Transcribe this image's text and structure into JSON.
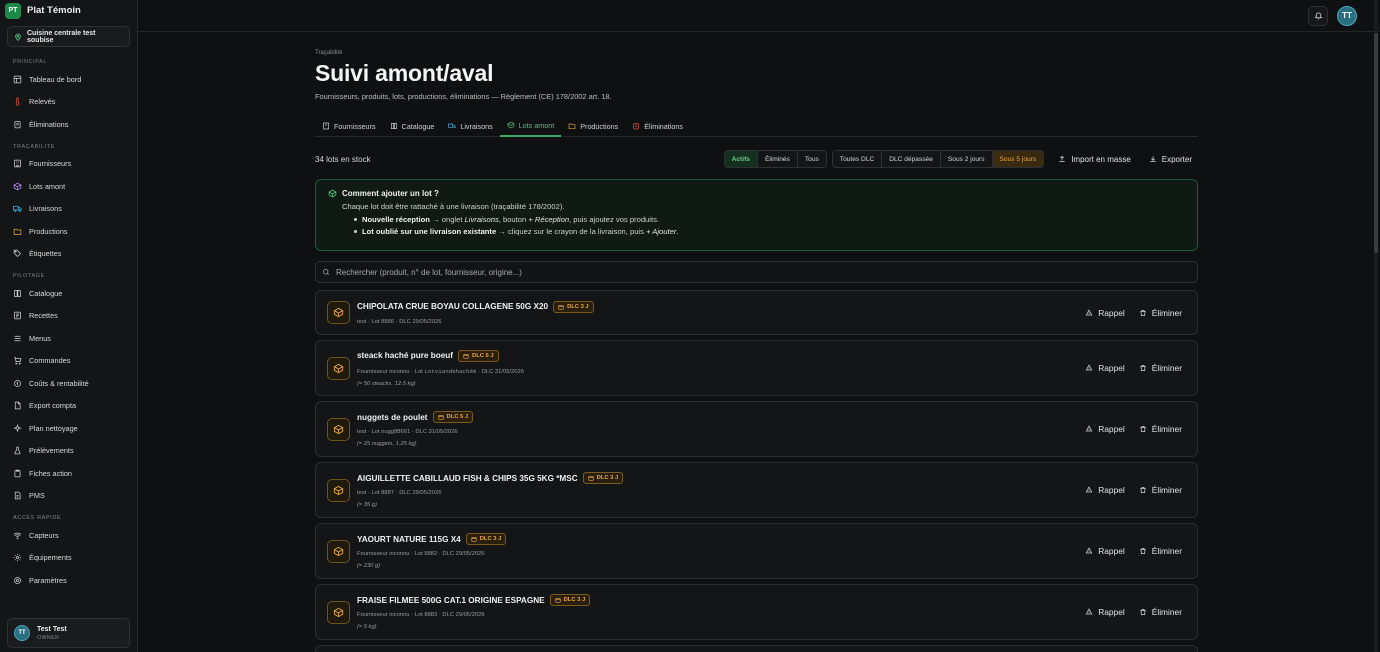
{
  "app": {
    "logo": "PT",
    "name": "Plat Témoin"
  },
  "site": {
    "label": "Cuisine centrale test soubise"
  },
  "sidebar": {
    "sections": [
      {
        "title": "PRINCIPAL",
        "items": [
          {
            "label": "Tableau de bord",
            "icon": "dashboard-icon"
          },
          {
            "label": "Relevés",
            "icon": "thermometer-icon"
          },
          {
            "label": "Éliminations",
            "icon": "trash-icon"
          }
        ]
      },
      {
        "title": "TRAÇABILITÉ",
        "items": [
          {
            "label": "Fournisseurs",
            "icon": "building-icon"
          },
          {
            "label": "Lots amont",
            "icon": "package-icon"
          },
          {
            "label": "Livraisons",
            "icon": "truck-icon"
          },
          {
            "label": "Productions",
            "icon": "folder-icon"
          },
          {
            "label": "Étiquettes",
            "icon": "tag-icon"
          }
        ]
      },
      {
        "title": "PILOTAGE",
        "items": [
          {
            "label": "Catalogue",
            "icon": "book-icon"
          },
          {
            "label": "Recettes",
            "icon": "list-icon"
          },
          {
            "label": "Menus",
            "icon": "menu-icon"
          },
          {
            "label": "Commandes",
            "icon": "cart-icon"
          },
          {
            "label": "Coûts & rentabilité",
            "icon": "coins-icon"
          },
          {
            "label": "Export compta",
            "icon": "file-icon"
          },
          {
            "label": "Plan nettoyage",
            "icon": "sparkle-icon"
          },
          {
            "label": "Prélèvements",
            "icon": "flask-icon"
          },
          {
            "label": "Fiches action",
            "icon": "clipboard-icon"
          },
          {
            "label": "PMS",
            "icon": "document-icon"
          }
        ]
      },
      {
        "title": "ACCÈS RAPIDE",
        "items": [
          {
            "label": "Capteurs",
            "icon": "wifi-icon"
          },
          {
            "label": "Équipements",
            "icon": "gear-icon"
          },
          {
            "label": "Paramètres",
            "icon": "settings-icon"
          }
        ]
      }
    ],
    "user": {
      "initials": "TT",
      "name": "Test Test",
      "role": "OWNER"
    }
  },
  "topbar": {
    "avatar": "TT"
  },
  "page": {
    "eyebrow": "Traçabilité",
    "title": "Suivi amont/aval",
    "subtitle": "Fournisseurs, produits, lots, productions, éliminations — Règlement (CE) 178/2002 art. 18."
  },
  "tabs": [
    "Fournisseurs",
    "Catalogue",
    "Livraisons",
    "Lots amont",
    "Productions",
    "Éliminations"
  ],
  "toolbar": {
    "count": "34 lots en stock",
    "status_filters": [
      "Actifs",
      "Éliminés",
      "Tous"
    ],
    "dlc_filters": [
      "Toutes DLC",
      "DLC dépassée",
      "Sous 2 jours",
      "Sous 5 jours"
    ],
    "import_label": "Import en masse",
    "export_label": "Exporter"
  },
  "info": {
    "title": "Comment ajouter un lot ?",
    "line": "Chaque lot doit être rattaché à une livraison (traçabilité 178/2002).",
    "b1_bold": "Nouvelle réception",
    "b1_a": " → onglet ",
    "b1_i1": "Livraisons",
    "b1_b": ", bouton ",
    "b1_i2": "+ Réception",
    "b1_c": ", puis ajoutez vos produits.",
    "b2_bold": "Lot oublié sur une livraison existante",
    "b2_a": " → cliquez sur le crayon de la livraison, puis ",
    "b2_i": "+ Ajouter",
    "b2_b": "."
  },
  "search": {
    "placeholder": "Rechercher (produit, n° de lot, fournisseur, origine...)"
  },
  "actions": {
    "recall": "Rappel",
    "discard": "Éliminer"
  },
  "lots": [
    {
      "name": "CHIPOLATA CRUE BOYAU COLLAGENE 50G X20",
      "badge": "DLC 3 J",
      "supplier": "test",
      "lot": "Lot 8886",
      "dlc": "DLC 29/05/2026",
      "qty": ""
    },
    {
      "name": "steack haché pure boeuf",
      "badge": "DLC 5 J",
      "supplier": "Fournisseur inconnu",
      "lot_prefix": "Lot ",
      "lot_code": "Lotviandehachéé",
      "dlc": "DLC 31/05/2026",
      "qty": "(≈ 50 steacks, 12.5 kg)"
    },
    {
      "name": "nuggets de poulet",
      "badge": "DLC 5 J",
      "supplier": "test",
      "lot": "Lot nugg88661",
      "dlc": "DLC 31/05/2026",
      "qty": "(≈ 25 nuggets, 1.25 kg)"
    },
    {
      "name": "AIGUILLETTE CABILLAUD FISH & CHIPS 35G 5KG *MSC",
      "badge": "DLC 3 J",
      "supplier": "test",
      "lot": "Lot 8887",
      "dlc": "DLC 29/05/2026",
      "qty": "(≈ 35 g)"
    },
    {
      "name": "YAOURT NATURE 115G X4",
      "badge": "DLC 3 J",
      "supplier": "Fournisseur inconnu",
      "lot": "Lot 8882",
      "dlc": "DLC 29/05/2026",
      "qty": "(≈ 230 g)"
    },
    {
      "name": "FRAISE FILMEE 500G CAT.1 ORIGINE ESPAGNE",
      "badge": "DLC 3 J",
      "supplier": "Fournisseur inconnu",
      "lot": "Lot 8883",
      "dlc": "DLC 29/05/2026",
      "qty": "(≈ 5 kg)"
    }
  ]
}
